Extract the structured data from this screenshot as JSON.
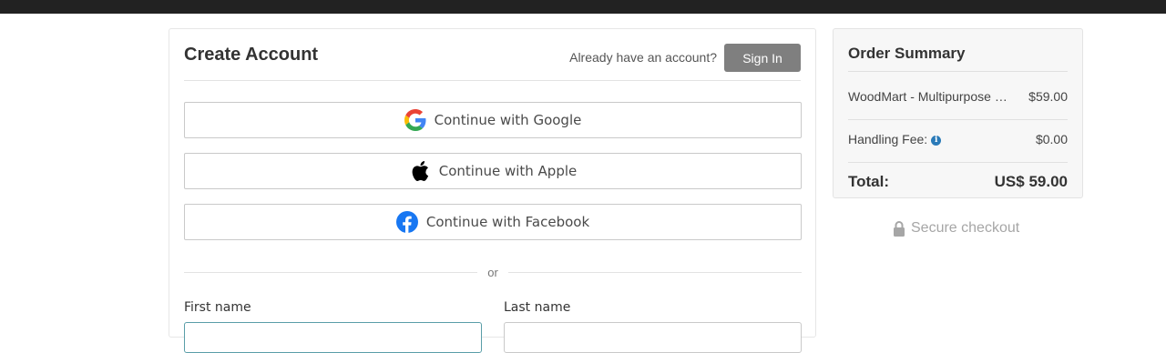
{
  "form": {
    "title": "Create Account",
    "already_text": "Already have an account?",
    "signin_label": "Sign In",
    "google_label": "Continue with Google",
    "apple_label": "Continue with Apple",
    "facebook_label": "Continue with Facebook",
    "divider_text": "or",
    "first_name_label": "First name",
    "last_name_label": "Last name",
    "first_name_value": "",
    "last_name_value": ""
  },
  "summary": {
    "title": "Order Summary",
    "items": [
      {
        "name": "WoodMart - Multipurpose WooCommerce Theme",
        "price": "$59.00"
      },
      {
        "name": "Handling Fee:",
        "price": "$0.00"
      }
    ],
    "total_label": "Total:",
    "total_value": "US$ 59.00"
  },
  "secure_text": "Secure checkout",
  "colors": {
    "topbar": "#222222",
    "signin_bg": "#7f7f7f",
    "focus_border": "#5a9ea8",
    "facebook_blue": "#1877f2",
    "info_blue": "#2a7ab8"
  },
  "icons": {
    "google": "google-g-icon",
    "apple": "apple-logo-icon",
    "facebook": "facebook-f-icon",
    "info": "info-circle-icon",
    "lock": "lock-icon"
  }
}
